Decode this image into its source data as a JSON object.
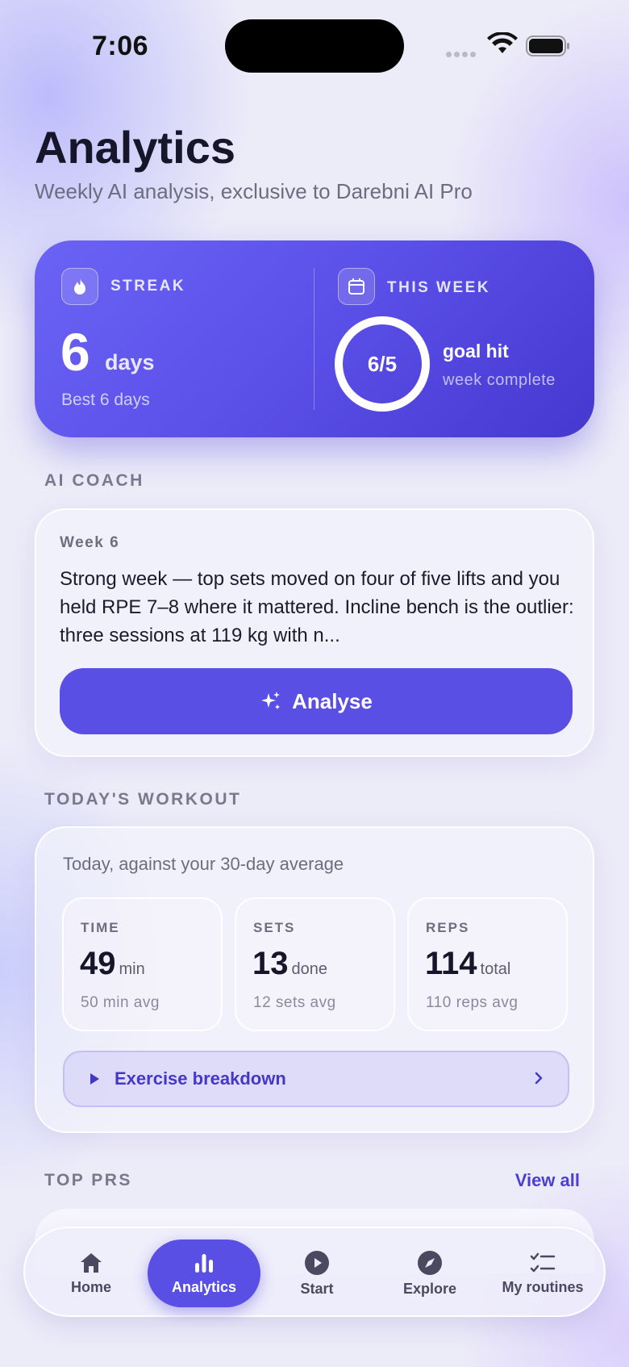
{
  "status_bar": {
    "time": "7:06"
  },
  "header": {
    "title": "Analytics",
    "subtitle": "Weekly AI analysis, exclusive to Darebni AI Pro"
  },
  "hero": {
    "streak_label": "STREAK",
    "streak_value": "6",
    "streak_unit": "days",
    "streak_best": "Best 6 days",
    "week_label": "THIS WEEK",
    "week_ratio": "6/5",
    "goal_title": "goal hit",
    "goal_subtitle": "week complete",
    "goal_progress": 1.0
  },
  "ai_coach": {
    "section_label": "AI COACH",
    "week": "Week 6",
    "summary": "Strong week — top sets moved on four of five lifts and you held RPE 7–8 where it mattered. Incline bench is the outlier: three sessions at 119 kg with n...",
    "button_label": "Analyse"
  },
  "todays_workout": {
    "section_label": "TODAY'S WORKOUT",
    "caption": "Today, against your 30-day average",
    "stats": [
      {
        "label": "TIME",
        "value": "49",
        "unit": "min",
        "avg": "50 min avg"
      },
      {
        "label": "SETS",
        "value": "13",
        "unit": "done",
        "avg": "12 sets avg"
      },
      {
        "label": "REPS",
        "value": "114",
        "unit": "total",
        "avg": "110 reps avg"
      }
    ],
    "breakdown_label": "Exercise breakdown"
  },
  "top_prs": {
    "section_label": "TOP PRS",
    "view_all": "View all"
  },
  "tab_bar": {
    "items": [
      {
        "label": "Home",
        "icon": "home-icon"
      },
      {
        "label": "Analytics",
        "icon": "bar-chart-icon",
        "active": true
      },
      {
        "label": "Start",
        "icon": "play-circle-icon"
      },
      {
        "label": "Explore",
        "icon": "compass-icon"
      },
      {
        "label": "My routines",
        "icon": "checklist-icon"
      }
    ]
  },
  "colors": {
    "accent": "#5a4fe4",
    "background": "#ecebf8",
    "text_primary": "#161529",
    "text_secondary": "#6e6c80"
  }
}
